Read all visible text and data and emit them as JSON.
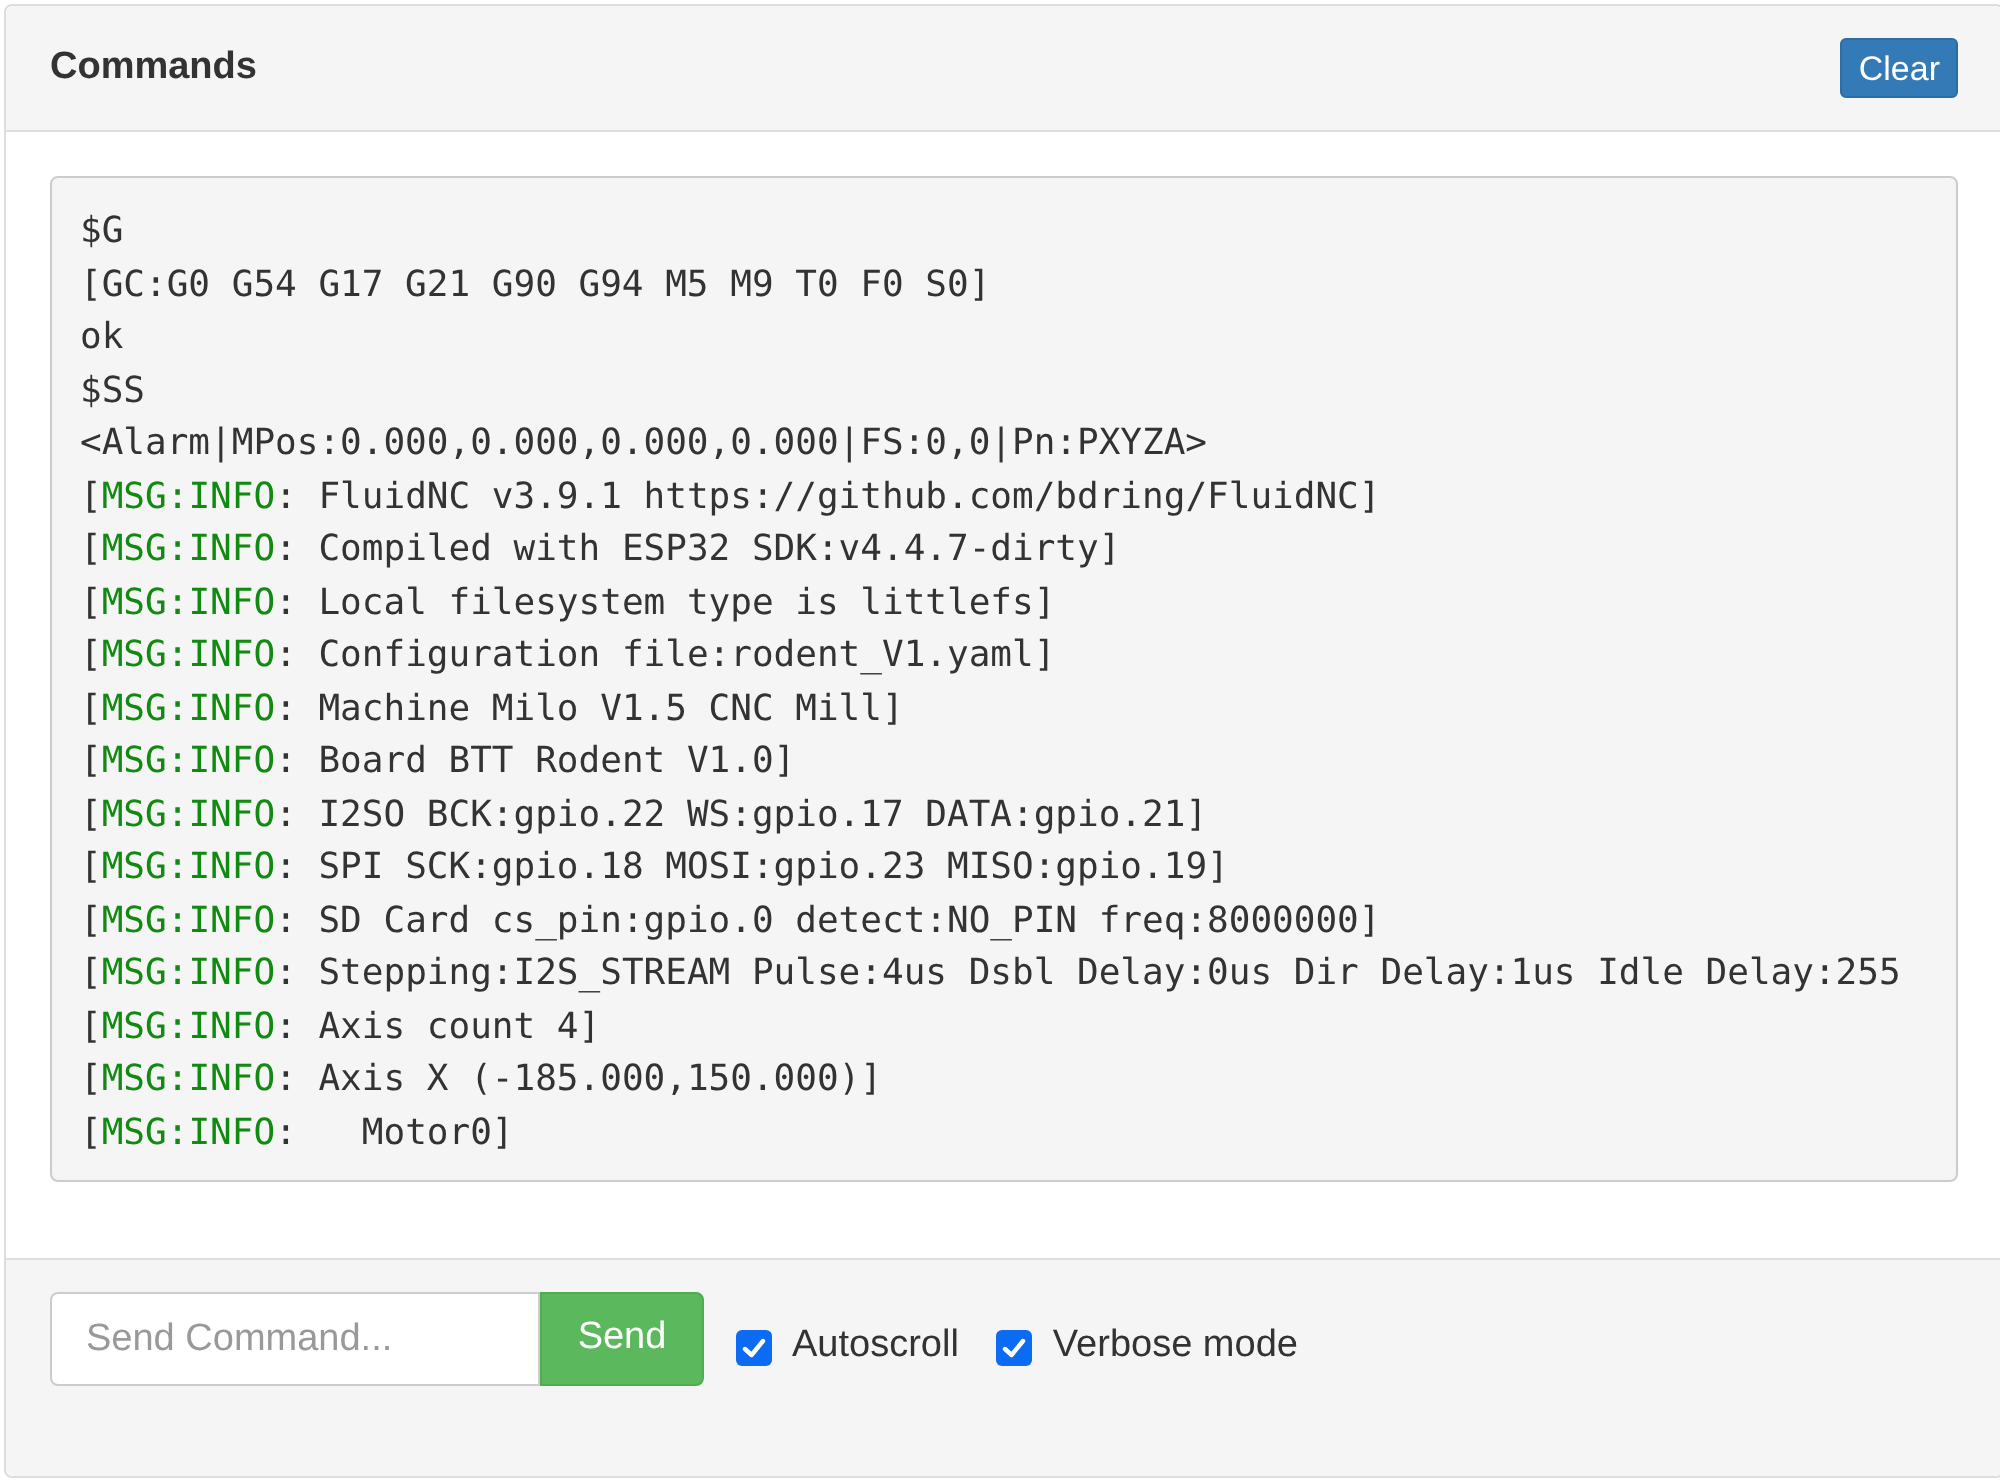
{
  "panel": {
    "title": "Commands",
    "clear_button": "Clear"
  },
  "console": {
    "lines": [
      {
        "kind": "plain",
        "text": "$G"
      },
      {
        "kind": "plain",
        "text": "[GC:G0 G54 G17 G21 G90 G94 M5 M9 T0 F0 S0]"
      },
      {
        "kind": "plain",
        "text": "ok"
      },
      {
        "kind": "plain",
        "text": "$SS"
      },
      {
        "kind": "plain",
        "text": "<Alarm|MPos:0.000,0.000,0.000,0.000|FS:0,0|Pn:PXYZA>"
      },
      {
        "kind": "info",
        "open": "[",
        "tag": "MSG:INFO",
        "text": ": FluidNC v3.9.1 https://github.com/bdring/FluidNC]"
      },
      {
        "kind": "info",
        "open": "[",
        "tag": "MSG:INFO",
        "text": ": Compiled with ESP32 SDK:v4.4.7-dirty]"
      },
      {
        "kind": "info",
        "open": "[",
        "tag": "MSG:INFO",
        "text": ": Local filesystem type is littlefs]"
      },
      {
        "kind": "info",
        "open": "[",
        "tag": "MSG:INFO",
        "text": ": Configuration file:rodent_V1.yaml]"
      },
      {
        "kind": "info",
        "open": "[",
        "tag": "MSG:INFO",
        "text": ": Machine Milo V1.5 CNC Mill]"
      },
      {
        "kind": "info",
        "open": "[",
        "tag": "MSG:INFO",
        "text": ": Board BTT Rodent V1.0]"
      },
      {
        "kind": "info",
        "open": "[",
        "tag": "MSG:INFO",
        "text": ": I2SO BCK:gpio.22 WS:gpio.17 DATA:gpio.21]"
      },
      {
        "kind": "info",
        "open": "[",
        "tag": "MSG:INFO",
        "text": ": SPI SCK:gpio.18 MOSI:gpio.23 MISO:gpio.19]"
      },
      {
        "kind": "info",
        "open": "[",
        "tag": "MSG:INFO",
        "text": ": SD Card cs_pin:gpio.0 detect:NO_PIN freq:8000000]"
      },
      {
        "kind": "info",
        "open": "[",
        "tag": "MSG:INFO",
        "text": ": Stepping:I2S_STREAM Pulse:4us Dsbl Delay:0us Dir Delay:1us Idle Delay:255"
      },
      {
        "kind": "info",
        "open": "[",
        "tag": "MSG:INFO",
        "text": ": Axis count 4]"
      },
      {
        "kind": "info",
        "open": "[",
        "tag": "MSG:INFO",
        "text": ": Axis X (-185.000,150.000)]"
      },
      {
        "kind": "info",
        "open": "[",
        "tag": "MSG:INFO",
        "text": ":   Motor0]"
      }
    ]
  },
  "command_input": {
    "placeholder": "Send Command..."
  },
  "send_button": "Send",
  "options": [
    {
      "label": "Autoscroll",
      "checked": true
    },
    {
      "label": "Verbose mode",
      "checked": true
    }
  ]
}
